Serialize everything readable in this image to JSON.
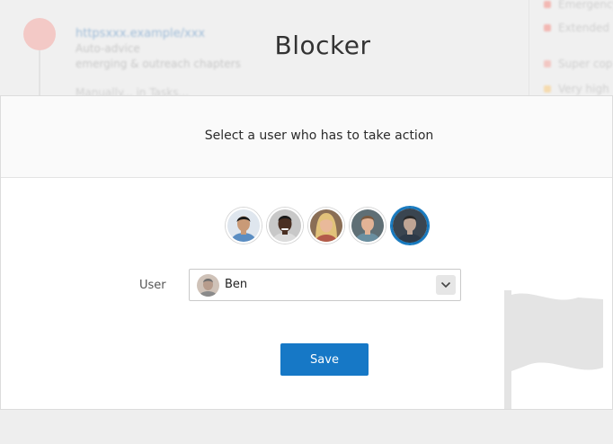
{
  "page": {
    "title": "Blocker"
  },
  "background": {
    "link": "httpsxxx.example/xxx",
    "subtitle_1": "Auto-advice",
    "subtitle_2": "emerging & outreach chapters",
    "subtitle_3": "Manually... in Tasks...",
    "side_items": [
      {
        "label": "Emergency",
        "color": "#f2b8b3"
      },
      {
        "label": "Extended",
        "color": "#f2b8b3"
      },
      {
        "label": "Super cop",
        "color": "#f2c7c3"
      },
      {
        "label": "Very high",
        "color": "#f5dbb0"
      }
    ]
  },
  "modal": {
    "header_text": "Select a user who has to take action",
    "avatars": [
      {
        "name": "user-1",
        "skin": "#c99a77",
        "hair": "#1a1a1a",
        "shirt": "#5a8dc2",
        "bg": "#dfe6ee",
        "selected": false
      },
      {
        "name": "user-2",
        "skin": "#4a2f22",
        "hair": "#1a1a1a",
        "shirt": "#dcdcdc",
        "bg": "#c8c8c8",
        "selected": false
      },
      {
        "name": "user-3",
        "skin": "#e9b99a",
        "hair": "#e2c27a",
        "shirt": "#b35a4a",
        "bg": "#8a6e55",
        "selected": false
      },
      {
        "name": "user-4",
        "skin": "#e2b396",
        "hair": "#7a5a40",
        "shirt": "#6a8fa0",
        "bg": "#5f6f75",
        "selected": false
      },
      {
        "name": "ben",
        "skin": "#bfa595",
        "hair": "#2a2a2a",
        "shirt": "#2d3a48",
        "bg": "#3a4550",
        "selected": true
      }
    ],
    "user_label": "User",
    "selected_user": "Ben",
    "save_label": "Save"
  },
  "colors": {
    "primary": "#1678c6",
    "selected_ring": "#1276bd"
  }
}
